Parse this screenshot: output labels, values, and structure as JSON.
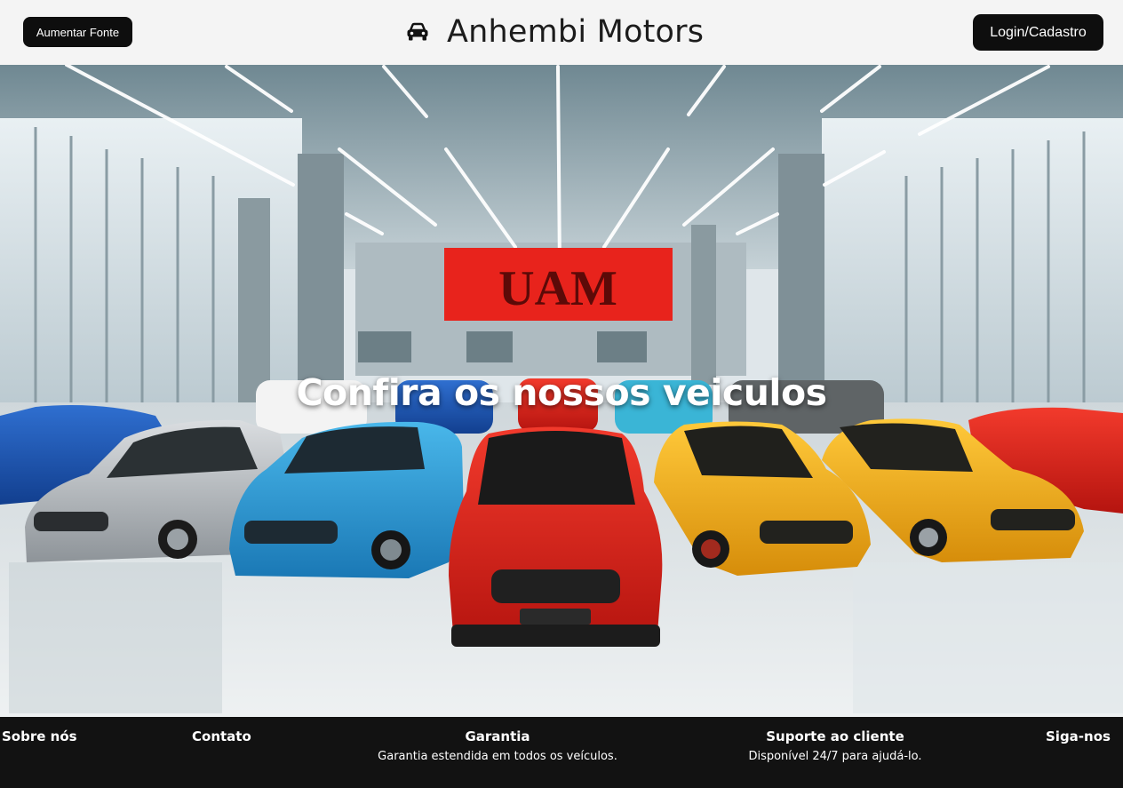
{
  "header": {
    "font_button_label": "Aumentar Fonte",
    "brand_icon": "car-icon",
    "brand_title": "Anhembi Motors",
    "login_button_label": "Login/Cadastro"
  },
  "hero": {
    "title": "Confira os nossos veiculos",
    "sign_text": "UAM"
  },
  "footer": {
    "about": {
      "heading": "Sobre nós"
    },
    "contact": {
      "heading": "Contato"
    },
    "warranty": {
      "heading": "Garantia",
      "text": "Garantia estendida em todos os veículos."
    },
    "support": {
      "heading": "Suporte ao cliente",
      "text": "Disponível 24/7 para ajudá-lo."
    },
    "social": {
      "heading": "Siga-nos"
    }
  },
  "colors": {
    "header_bg": "#f4f4f4",
    "button_bg": "#0e0e0e",
    "footer_bg": "#121212",
    "sign_red": "#e8231c",
    "car_red": "#e02a22",
    "car_blue": "#2a9fd8",
    "car_yellow": "#f2b01c",
    "car_silver": "#b8bcc0"
  }
}
